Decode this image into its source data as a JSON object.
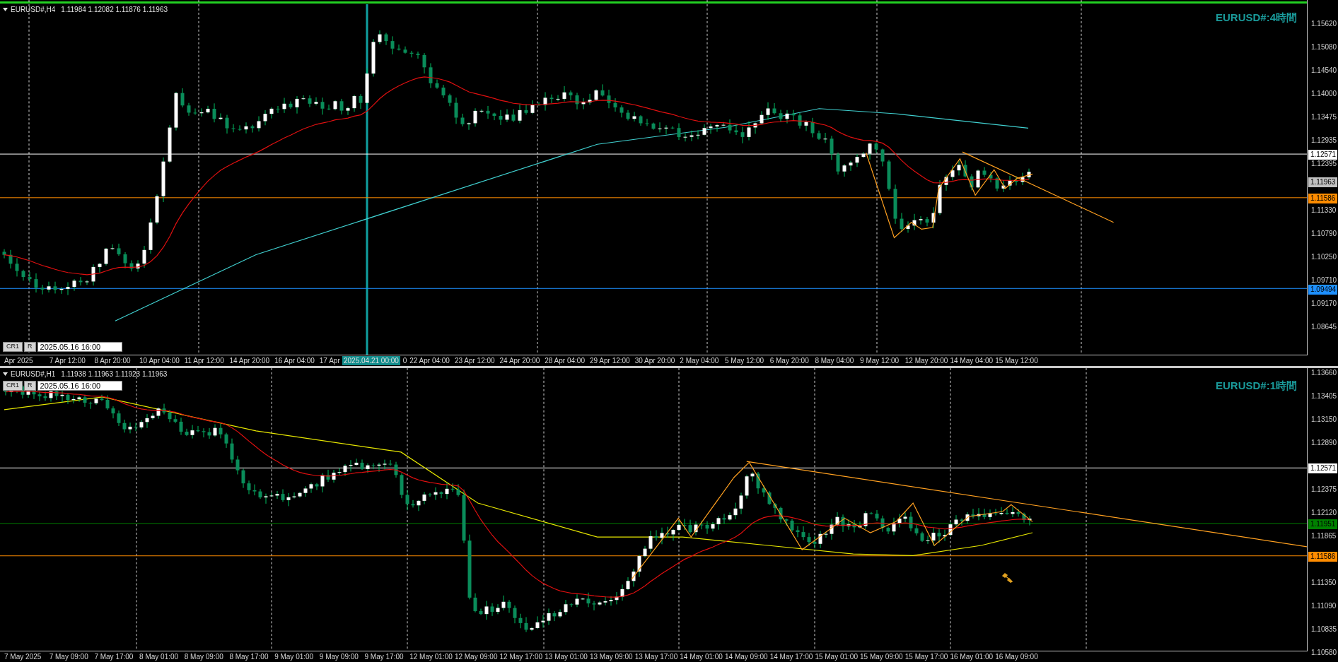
{
  "panes": [
    {
      "header": {
        "symbol": "EURUSD#,H4",
        "quotes": "1.11984 1.12082 1.11876 1.11963"
      },
      "title": "EURUSD#:4時間",
      "buttons": [
        "CR1",
        "R"
      ],
      "date": "2025.05.16 16:00",
      "price_labels": [
        "1.15620",
        "1.15080",
        "1.14540",
        "1.14000",
        "1.13475",
        "1.12935",
        "1.12395",
        "1.11330",
        "1.10790",
        "1.10250",
        "1.09710",
        "1.09170",
        "1.08645"
      ],
      "price_tags": [
        {
          "text": "1.12571",
          "color": "#ffffff"
        },
        {
          "text": "1.11963",
          "color": "#c0c0c0"
        },
        {
          "text": "1.11586",
          "color": "#ff8c00"
        },
        {
          "text": "1.09494",
          "color": "#1e90ff"
        }
      ],
      "time_labels": [
        {
          "text": "Apr 2025"
        },
        {
          "text": "7 Apr 12:00"
        },
        {
          "text": "8 Apr 20:00"
        },
        {
          "text": "10 Apr 04:00"
        },
        {
          "text": "11 Apr 12:00"
        },
        {
          "text": "14 Apr 20:00"
        },
        {
          "text": "16 Apr 04:00"
        },
        {
          "text": "17 Apr"
        },
        {
          "text": "0",
          "kind": "partial"
        },
        {
          "text": "22 Apr 04:00"
        },
        {
          "text": "23 Apr 12:00"
        },
        {
          "text": "24 Apr 20:00"
        },
        {
          "text": "28 Apr 04:00"
        },
        {
          "text": "29 Apr 12:00"
        },
        {
          "text": "30 Apr 20:00"
        },
        {
          "text": "2 May 04:00"
        },
        {
          "text": "5 May 12:00"
        },
        {
          "text": "6 May 20:00"
        },
        {
          "text": "8 May 04:00"
        },
        {
          "text": "9 May 12:00"
        },
        {
          "text": "12 May 20:00"
        },
        {
          "text": "14 May 04:00"
        },
        {
          "text": "15 May 12:00"
        }
      ],
      "time_cursor": "2025.04.21 00:00"
    },
    {
      "header": {
        "symbol": "EURUSD#,H1",
        "quotes": "1.11938 1.11963 1.11923 1.11963"
      },
      "title": "EURUSD#:1時間",
      "buttons": [
        "CR1",
        "R"
      ],
      "date": "2025.05.16 16:00",
      "price_labels": [
        "1.13660",
        "1.13405",
        "1.13150",
        "1.12890",
        "1.12375",
        "1.12120",
        "1.11865",
        "1.11350",
        "1.11090",
        "1.10835",
        "1.10580"
      ],
      "price_tags": [
        {
          "text": "1.12571",
          "color": "#ffffff"
        },
        {
          "text": "1.11951",
          "color": "#008000"
        },
        {
          "text": "1.11586",
          "color": "#ff8c00"
        }
      ],
      "time_labels": [
        {
          "text": "7 May 2025"
        },
        {
          "text": "7 May 09:00"
        },
        {
          "text": "7 May 17:00"
        },
        {
          "text": "8 May 01:00"
        },
        {
          "text": "8 May 09:00"
        },
        {
          "text": "8 May 17:00"
        },
        {
          "text": "9 May 01:00"
        },
        {
          "text": "9 May 09:00"
        },
        {
          "text": "9 May 17:00"
        },
        {
          "text": "12 May 01:00"
        },
        {
          "text": "12 May 09:00"
        },
        {
          "text": "12 May 17:00"
        },
        {
          "text": "13 May 01:00"
        },
        {
          "text": "13 May 09:00"
        },
        {
          "text": "13 May 17:00"
        },
        {
          "text": "14 May 01:00"
        },
        {
          "text": "14 May 09:00"
        },
        {
          "text": "14 May 17:00"
        },
        {
          "text": "15 May 01:00"
        },
        {
          "text": "15 May 09:00"
        },
        {
          "text": "15 May 17:00"
        },
        {
          "text": "16 May 01:00"
        },
        {
          "text": "16 May 09:00"
        }
      ]
    }
  ]
}
